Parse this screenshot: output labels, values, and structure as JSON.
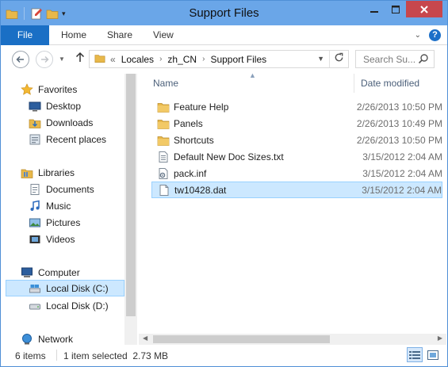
{
  "window": {
    "title": "Support Files"
  },
  "ribbon": {
    "tabs": [
      "File",
      "Home",
      "Share",
      "View"
    ],
    "help": "?"
  },
  "address": {
    "crumbs": [
      "Locales",
      "zh_CN",
      "Support Files"
    ],
    "overflow": "«",
    "search_placeholder": "Search Su..."
  },
  "nav": {
    "favorites": "Favorites",
    "desktop": "Desktop",
    "downloads": "Downloads",
    "recent": "Recent places",
    "libraries": "Libraries",
    "documents": "Documents",
    "music": "Music",
    "pictures": "Pictures",
    "videos": "Videos",
    "computer": "Computer",
    "local_c": "Local Disk (C:)",
    "local_d": "Local Disk (D:)",
    "network": "Network"
  },
  "columns": {
    "name": "Name",
    "date": "Date modified"
  },
  "files": [
    {
      "name": "Feature Help",
      "date": "2/26/2013 10:50 PM",
      "icon": "folder-icon"
    },
    {
      "name": "Panels",
      "date": "2/26/2013 10:49 PM",
      "icon": "folder-icon"
    },
    {
      "name": "Shortcuts",
      "date": "2/26/2013 10:50 PM",
      "icon": "folder-icon"
    },
    {
      "name": "Default New Doc Sizes.txt",
      "date": "3/15/2012 2:04 AM",
      "icon": "text-file-icon"
    },
    {
      "name": "pack.inf",
      "date": "3/15/2012 2:04 AM",
      "icon": "settings-file-icon"
    },
    {
      "name": "tw10428.dat",
      "date": "3/15/2012 2:04 AM",
      "icon": "file-icon"
    }
  ],
  "status": {
    "count": "6 items",
    "selection": "1 item selected  2.73 MB"
  },
  "colors": {
    "titlebar": "#6aa6e8",
    "file_tab": "#1a6fc5",
    "selection": "#cce8ff",
    "folder": "#e8b84a"
  }
}
